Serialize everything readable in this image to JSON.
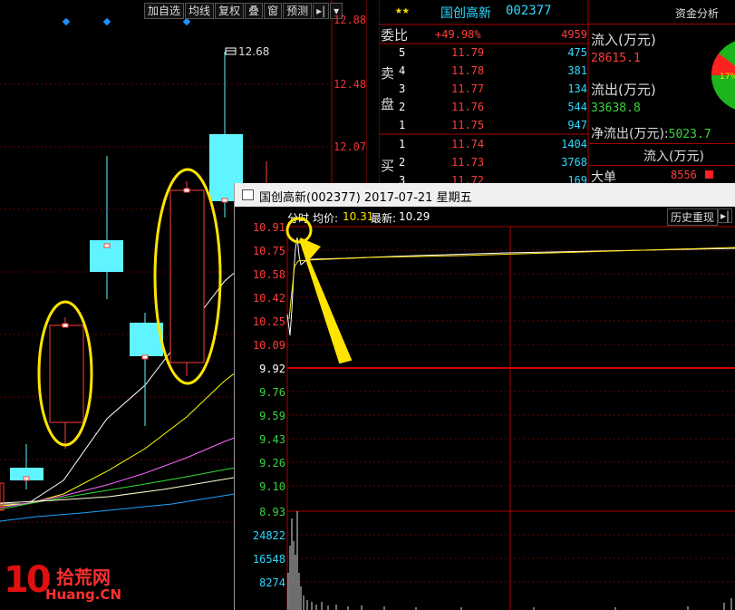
{
  "kline": {
    "toolbar": [
      "加自选",
      "均线",
      "复权",
      "叠",
      "窗",
      "预测"
    ],
    "toolbar_more": "▸|",
    "high_label": "12.68",
    "price_ticks": [
      "12.88",
      "12.48",
      "12.07"
    ]
  },
  "quote": {
    "name": "国创高新",
    "code": "002377",
    "stars": "★★",
    "weibi_label": "委比",
    "weibi_value": "+49.98%",
    "weibi_diff": "4959",
    "sell_label_1": "卖",
    "sell_label_2": "盘",
    "buy_label": "买",
    "sells": [
      {
        "level": "5",
        "price": "11.79",
        "vol": "475"
      },
      {
        "level": "4",
        "price": "11.78",
        "vol": "381"
      },
      {
        "level": "3",
        "price": "11.77",
        "vol": "134"
      },
      {
        "level": "2",
        "price": "11.76",
        "vol": "544"
      },
      {
        "level": "1",
        "price": "11.75",
        "vol": "947"
      }
    ],
    "buys": [
      {
        "level": "1",
        "price": "11.74",
        "vol": "1404"
      },
      {
        "level": "2",
        "price": "11.73",
        "vol": "3768"
      },
      {
        "level": "3",
        "price": "11.72",
        "vol": "169"
      }
    ]
  },
  "fund": {
    "title": "资金分析",
    "inflow_label": "流入(万元)",
    "inflow_value": "28615.1",
    "outflow_label": "流出(万元)",
    "outflow_value": "33638.8",
    "net_label": "净流出(万元):",
    "net_value": "5023.7",
    "col_header": "流入(万元)",
    "big_label": "大单",
    "big_value": "8556",
    "pie_pct": "17%"
  },
  "intraday": {
    "window_title": "国创高新(002377) 2017-07-21 星期五",
    "time_label": "分时",
    "avg_label": "均价:",
    "avg_value": "10.31",
    "last_label": "最新:",
    "last_value": "10.29",
    "history_button": "历史重现",
    "price_axis_red": [
      "10.91",
      "10.75",
      "10.58",
      "10.42",
      "10.25",
      "10.09"
    ],
    "price_axis_mid": "9.92",
    "price_axis_green": [
      "9.76",
      "9.59",
      "9.43",
      "9.26",
      "9.10",
      "8.93"
    ],
    "vol_axis": [
      "24822",
      "16548",
      "8274"
    ]
  },
  "watermark": {
    "logo_num": "10",
    "logo_cn": "拾荒网",
    "logo_en": "Huang.CN"
  },
  "colors": {
    "up": "#ff3b3b",
    "down": "#3cd43c",
    "candle_down_fill": "#5ff4ff",
    "grid": "#8b0000",
    "highlight": "#ffe400"
  }
}
